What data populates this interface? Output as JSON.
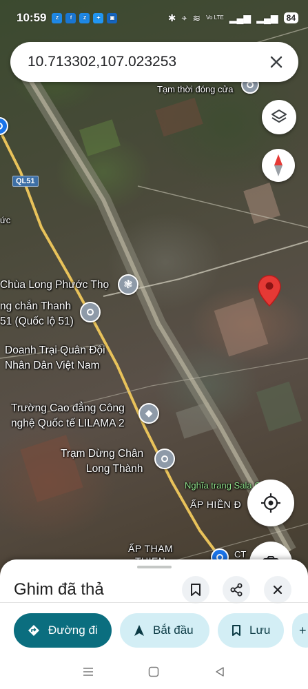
{
  "status_bar": {
    "time": "10:59",
    "app_icons": [
      {
        "name": "zalo-icon",
        "color": "#1e88e5",
        "text": "Zalo"
      },
      {
        "name": "app-f-icon",
        "color": "#1976d2",
        "text": "f"
      },
      {
        "name": "zalo-icon-2",
        "color": "#1e88e5",
        "text": "Zalo"
      },
      {
        "name": "bird-icon",
        "color": "#2196f3",
        "text": "✦"
      },
      {
        "name": "tv-app-icon",
        "color": "#1565c0",
        "text": "▣"
      }
    ],
    "network_label": "Vo LTE",
    "battery": "84"
  },
  "search": {
    "value": "10.713302,107.023253"
  },
  "map": {
    "labels": {
      "temporarily_closed": "Tạm thời đóng cửa",
      "road_ql51": "QL51",
      "edge_fragment": "ức",
      "pagoda": "Chùa Long Phước Thọ",
      "toll_station_line1": "ng chắn Thanh",
      "toll_station_line2": "51 (Quốc lộ 51)",
      "military_camp_line1": "Doanh Trại Quân Đội",
      "military_camp_line2": "Nhân Dân Việt Nam",
      "college_line1": "Trường Cao đẳng Công",
      "college_line2": "nghệ Quốc tế LILAMA 2",
      "rest_stop_line1": "Trạm Dừng Chân",
      "rest_stop_line2": "Long Thành",
      "cemetery": "Nghĩa trang Sala Garden",
      "hamlet_hien_duc": "ẤP HIỀN Đ",
      "hamlet_tham_thien_1": "ẤP THAM",
      "hamlet_tham_thien_2": "THIEN",
      "ct_fragment": "CT"
    }
  },
  "bottom_sheet": {
    "title": "Ghim đã thả",
    "actions": {
      "directions": "Đường đi",
      "start": "Bắt đầu",
      "save": "Lưu"
    }
  },
  "colors": {
    "primary_chip": "#0b6e7f",
    "secondary_chip": "#d3eef5",
    "pin_red": "#e53935",
    "poi_gray": "#8e9aa8",
    "road_yellow": "#e8c25a"
  }
}
